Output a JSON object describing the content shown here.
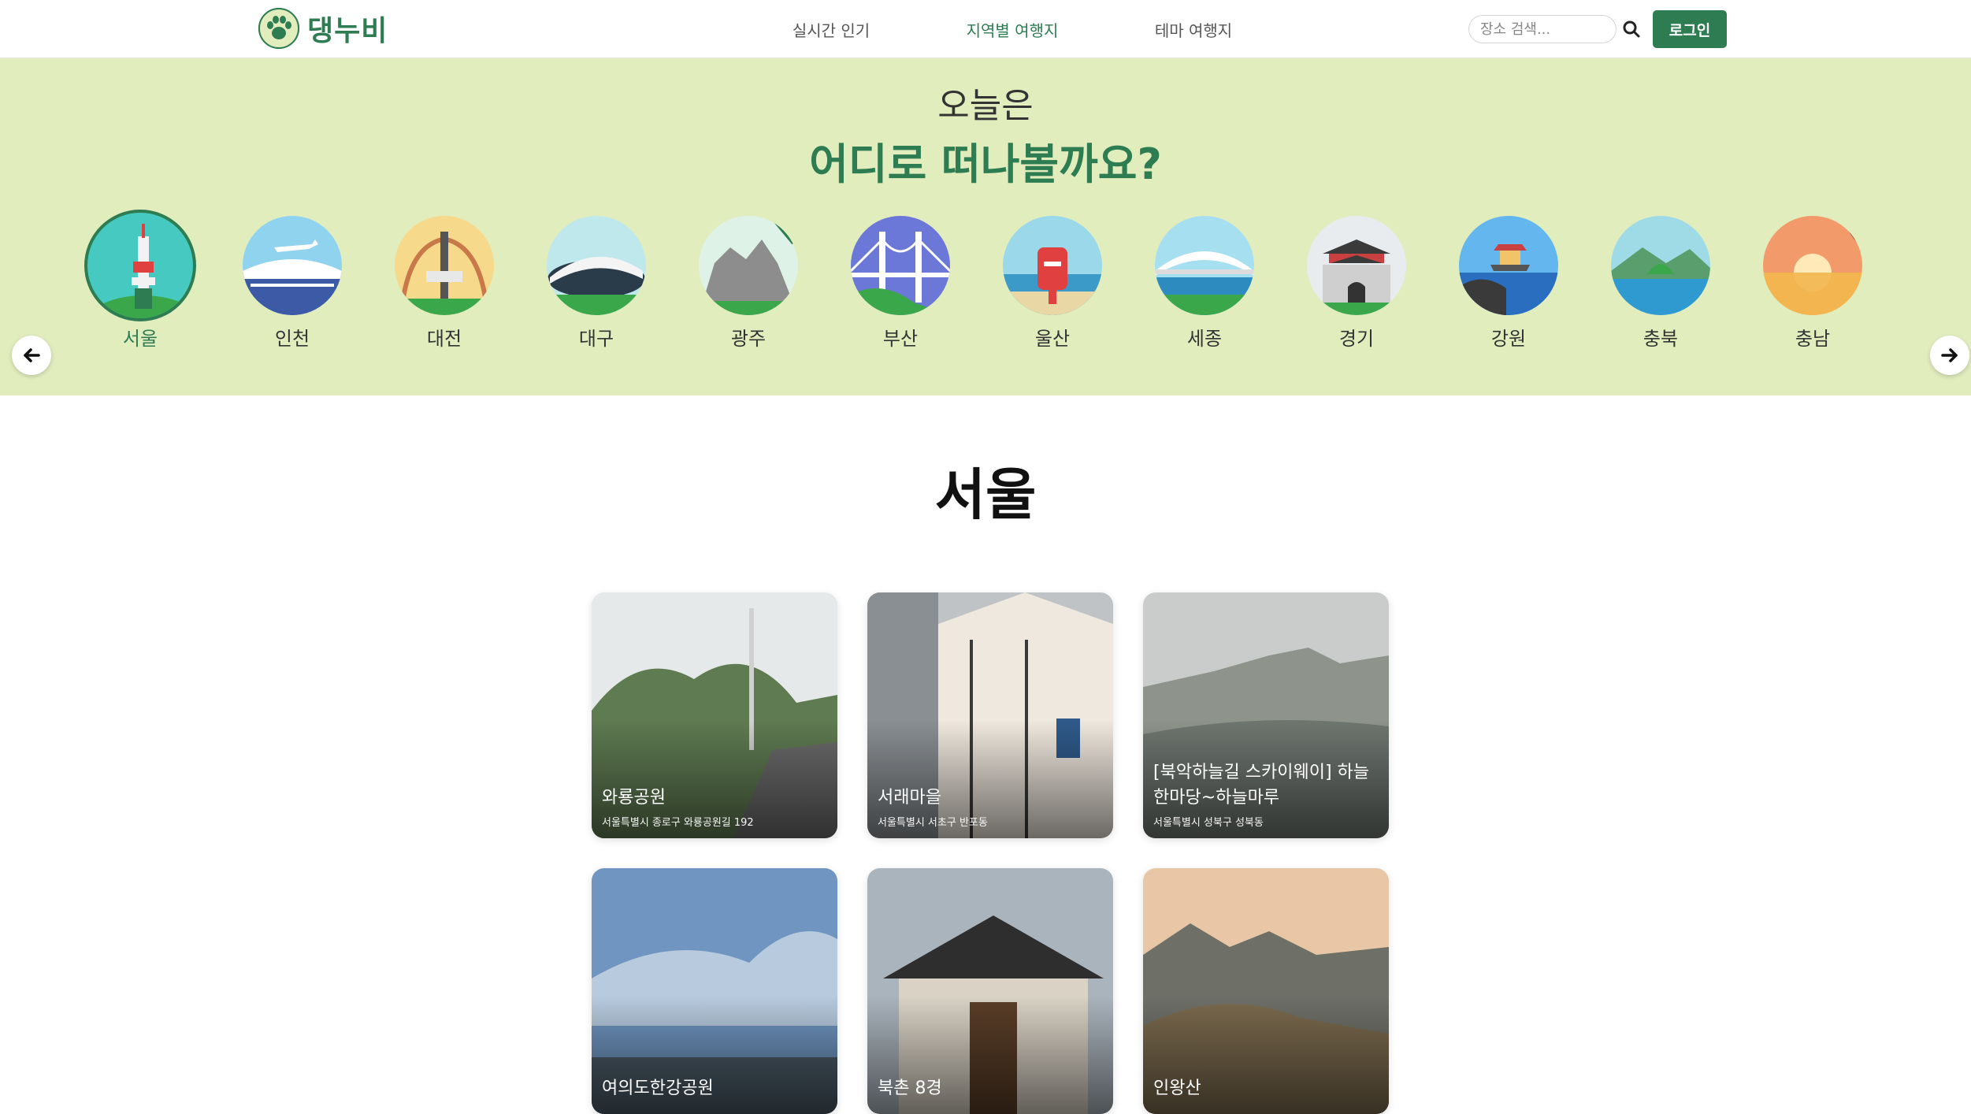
{
  "header": {
    "logo_text": "댕누비",
    "nav": [
      "실시간 인기",
      "지역별 여행지",
      "테마 여행지"
    ],
    "active_nav": "지역별 여행지",
    "search_placeholder": "장소 검색...",
    "login_label": "로그인"
  },
  "hero": {
    "line1": "오늘은",
    "line2": "어디로 떠나볼까요?"
  },
  "regions": [
    {
      "label": "서울",
      "icon": "seoul-tower-icon"
    },
    {
      "label": "인천",
      "icon": "incheon-airport-icon"
    },
    {
      "label": "대전",
      "icon": "daejeon-tower-icon"
    },
    {
      "label": "대구",
      "icon": "daegu-stadium-icon"
    },
    {
      "label": "광주",
      "icon": "gwangju-mountain-icon"
    },
    {
      "label": "부산",
      "icon": "busan-bridge-icon"
    },
    {
      "label": "울산",
      "icon": "ulsan-mailbox-icon"
    },
    {
      "label": "세종",
      "icon": "sejong-bridge-icon"
    },
    {
      "label": "경기",
      "icon": "gyeonggi-fortress-icon"
    },
    {
      "label": "강원",
      "icon": "gangwon-pavilion-icon"
    },
    {
      "label": "충북",
      "icon": "chungbuk-island-icon"
    },
    {
      "label": "충남",
      "icon": "chungnam-sunset-icon"
    }
  ],
  "selected_region": "서울",
  "section_title": "서울",
  "cards": [
    {
      "title": "와룡공원",
      "address": "서울특별시 종로구 와룡공원길 192"
    },
    {
      "title": "서래마을",
      "address": "서울특별시 서초구 반포동"
    },
    {
      "title": "[북악하늘길 스카이웨이] 하늘한마당~하늘마루",
      "address": "서울특별시 성북구 성북동"
    },
    {
      "title": "여의도한강공원",
      "address": ""
    },
    {
      "title": "북촌 8경",
      "address": ""
    },
    {
      "title": "인왕산",
      "address": ""
    }
  ]
}
